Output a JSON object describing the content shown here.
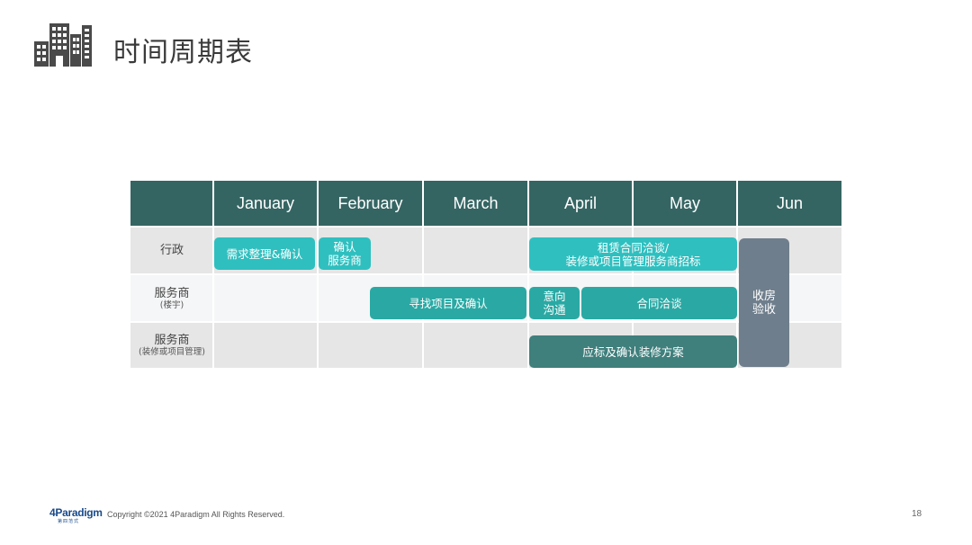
{
  "header": {
    "title": "时间周期表",
    "icon": "buildings-icon"
  },
  "table": {
    "columns": [
      "January",
      "February",
      "March",
      "April",
      "May",
      "Jun"
    ],
    "rows": [
      {
        "label": "行政",
        "sublabel": ""
      },
      {
        "label": "服务商",
        "sublabel": "(楼宇)"
      },
      {
        "label": "服务商",
        "sublabel": "(装修或项目管理)"
      }
    ],
    "tasks": {
      "needs": "需求整理&确认",
      "confirm_vendor": [
        "确认",
        "服务商"
      ],
      "lease": [
        "租赁合同洽谈/",
        "装修或项目管理服务商招标"
      ],
      "find_project": "寻找项目及确认",
      "intent": [
        "意向",
        "沟通"
      ],
      "contract": "合同洽谈",
      "bid": "应标及确认装修方案",
      "handover": [
        "收房",
        "验收"
      ]
    },
    "colors": {
      "header_bg": "#356563",
      "task_cyan": "#2fbfbf",
      "task_teal": "#2aa9a4",
      "task_dark_teal": "#3f7f7c",
      "milestone_gray": "#6f7e8c"
    }
  },
  "footer": {
    "logo": "4Paradigm",
    "logo_sub": "第四范式",
    "copyright": "Copyright ©2021 4Paradigm All Rights Reserved.",
    "page": "18"
  }
}
